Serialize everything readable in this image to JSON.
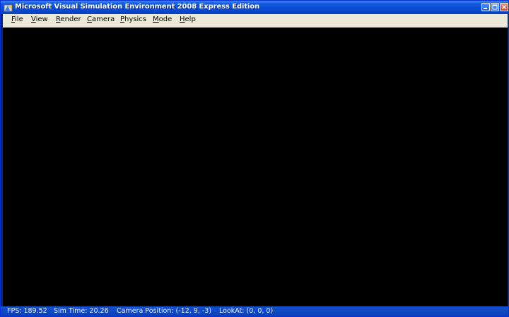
{
  "window": {
    "title": "Microsoft Visual Simulation Environment 2008 Express Edition"
  },
  "menu": {
    "items": [
      {
        "accel": "F",
        "rest": "ile"
      },
      {
        "accel": "V",
        "rest": "iew"
      },
      {
        "accel": "R",
        "rest": "ender"
      },
      {
        "accel": "C",
        "rest": "amera"
      },
      {
        "accel": "P",
        "rest": "hysics"
      },
      {
        "accel": "M",
        "rest": "ode"
      },
      {
        "accel": "H",
        "rest": "elp"
      }
    ]
  },
  "status": {
    "fps": "FPS: 189.52",
    "sim_time": "Sim Time: 20.26",
    "camera_position": "Camera Position: (-12, 9, -3)",
    "look_at": "LookAt: (0, 0, 0)"
  },
  "icons": {
    "app": "app-icon",
    "minimize": "minimize-icon",
    "maximize": "maximize-icon",
    "close": "close-icon"
  },
  "colors": {
    "titlebar": "#0b4fd7",
    "menubar": "#ece9d8",
    "viewport": "#000000",
    "statusbar": "#0a3fb5",
    "close_button": "#c9452a"
  }
}
